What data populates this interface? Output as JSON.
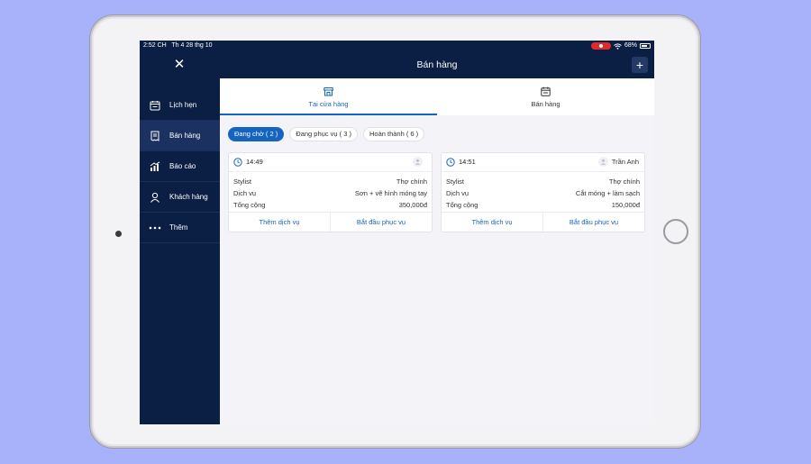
{
  "status": {
    "time": "2:52 CH",
    "date": "Th 4 28 thg 10",
    "battery": "68%"
  },
  "sidebar": {
    "items": [
      {
        "label": "Lịch hẹn",
        "icon": "calendar-icon"
      },
      {
        "label": "Bán hàng",
        "icon": "receipt-icon",
        "active": true
      },
      {
        "label": "Báo cáo",
        "icon": "bar-chart-icon"
      },
      {
        "label": "Khách hàng",
        "icon": "user-icon"
      },
      {
        "label": "Thêm",
        "icon": "more-icon"
      }
    ]
  },
  "header": {
    "title": "Bán hàng",
    "add": "+"
  },
  "tabs": [
    {
      "label": "Tại cửa hàng",
      "icon": "store-icon",
      "active": true
    },
    {
      "label": "Bán hàng",
      "icon": "calendar-icon"
    }
  ],
  "filters": [
    {
      "label": "Đang chờ ( 2 )",
      "active": true
    },
    {
      "label": "Đang phục vụ ( 3 )"
    },
    {
      "label": "Hoàn thành ( 6 )"
    }
  ],
  "orders": [
    {
      "time": "14:49",
      "staff": "",
      "rows": [
        {
          "k": "Stylist",
          "v": "Thợ chính"
        },
        {
          "k": "Dịch vụ",
          "v": "Sơn + vẽ hình móng tay"
        },
        {
          "k": "Tổng cộng",
          "v": "350,000đ"
        }
      ],
      "action_add": "Thêm dịch vụ",
      "action_start": "Bắt đầu phục vụ"
    },
    {
      "time": "14:51",
      "staff": "Trần Anh",
      "rows": [
        {
          "k": "Stylist",
          "v": "Thợ chính"
        },
        {
          "k": "Dịch vụ",
          "v": "Cắt móng + làm sạch"
        },
        {
          "k": "Tổng cộng",
          "v": "150,000đ"
        }
      ],
      "action_add": "Thêm dịch vụ",
      "action_start": "Bắt đầu phục vụ"
    }
  ],
  "colors": {
    "navy": "#0b1f45",
    "accent": "#1565c0",
    "record": "#e02a2a"
  }
}
